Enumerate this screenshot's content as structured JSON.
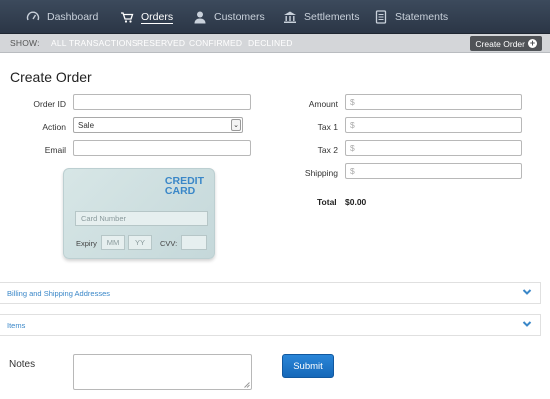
{
  "nav": {
    "items": [
      {
        "label": "Dashboard",
        "icon": "dashboard-gauge-icon"
      },
      {
        "label": "Orders",
        "icon": "cart-icon",
        "active": true
      },
      {
        "label": "Customers",
        "icon": "user-icon"
      },
      {
        "label": "Settlements",
        "icon": "bank-icon"
      },
      {
        "label": "Statements",
        "icon": "document-icon"
      }
    ]
  },
  "subnav": {
    "show_label": "SHOW:",
    "filters": [
      "ALL TRANSACTIONS",
      "RESERVED",
      "CONFIRMED",
      "DECLINED"
    ],
    "create_label": "Create Order",
    "create_icon": "plus-circle-icon"
  },
  "page": {
    "title": "Create Order"
  },
  "form": {
    "order_id_label": "Order ID",
    "action_label": "Action",
    "action_value": "Sale",
    "email_label": "Email",
    "amount_label": "Amount",
    "tax1_label": "Tax 1",
    "tax2_label": "Tax 2",
    "shipping_label": "Shipping",
    "currency_placeholder": "$",
    "total_label": "Total",
    "total_value": "$0.00"
  },
  "card": {
    "title_line1": "CREDIT",
    "title_line2": "CARD",
    "number_placeholder": "Card Number",
    "expiry_label": "Expiry",
    "mm_placeholder": "MM",
    "yy_placeholder": "YY",
    "cvv_label": "CVV:"
  },
  "sections": {
    "billing_label": "Billing and Shipping Addresses",
    "items_label": "Items"
  },
  "notes_label": "Notes",
  "submit_label": "Submit",
  "colors": {
    "nav_bg": "#2f3a4a",
    "accent": "#3a87c8",
    "submit": "#1a74c7"
  }
}
